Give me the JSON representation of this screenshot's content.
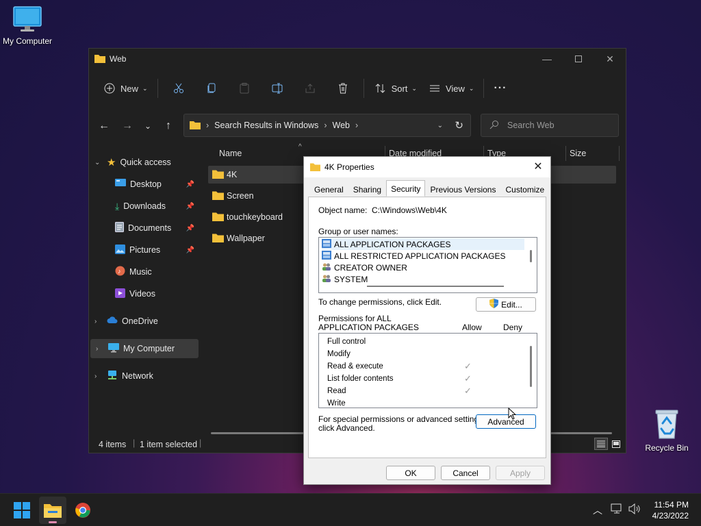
{
  "desktop": {
    "my_computer": "My Computer",
    "recycle_bin": "Recycle Bin"
  },
  "explorer": {
    "title": "Web",
    "toolbar": {
      "new": "New",
      "sort": "Sort",
      "view": "View",
      "more": "···"
    },
    "address": {
      "crumb1": "Search Results in Windows",
      "crumb2": "Web",
      "sep": "›"
    },
    "search_placeholder": "Search Web",
    "nav": {
      "quick_access": "Quick access",
      "desktop": "Desktop",
      "downloads": "Downloads",
      "documents": "Documents",
      "pictures": "Pictures",
      "music": "Music",
      "videos": "Videos",
      "onedrive": "OneDrive",
      "my_computer": "My Computer",
      "network": "Network"
    },
    "columns": {
      "name": "Name",
      "date": "Date modified",
      "type": "Type",
      "size": "Size"
    },
    "files": [
      "4K",
      "Screen",
      "touchkeyboard",
      "Wallpaper"
    ],
    "status": {
      "items": "4 items",
      "selected": "1 item selected"
    }
  },
  "props": {
    "title": "4K Properties",
    "tabs": [
      "General",
      "Sharing",
      "Security",
      "Previous Versions",
      "Customize"
    ],
    "object_label": "Object name:",
    "object_value": "C:\\Windows\\Web\\4K",
    "group_label": "Group or user names:",
    "groups": [
      "ALL APPLICATION PACKAGES",
      "ALL RESTRICTED APPLICATION PACKAGES",
      "CREATOR OWNER",
      "SYSTEM"
    ],
    "change_text": "To change permissions, click Edit.",
    "edit": "Edit...",
    "perm_label_1": "Permissions for ALL",
    "perm_label_2": "APPLICATION PACKAGES",
    "allow": "Allow",
    "deny": "Deny",
    "permissions": [
      {
        "name": "Full control",
        "allow": false
      },
      {
        "name": "Modify",
        "allow": false
      },
      {
        "name": "Read & execute",
        "allow": true
      },
      {
        "name": "List folder contents",
        "allow": true
      },
      {
        "name": "Read",
        "allow": true
      },
      {
        "name": "Write",
        "allow": false
      }
    ],
    "special_1": "For special permissions or advanced settings,",
    "special_2": "click Advanced.",
    "advanced": "Advanced",
    "ok": "OK",
    "cancel": "Cancel",
    "apply": "Apply"
  },
  "taskbar": {
    "time": "11:54 PM",
    "date": "4/23/2022"
  },
  "colors": {
    "folder": "#f3c03a",
    "accent": "#0067c0",
    "explorer_bg": "#202020"
  }
}
